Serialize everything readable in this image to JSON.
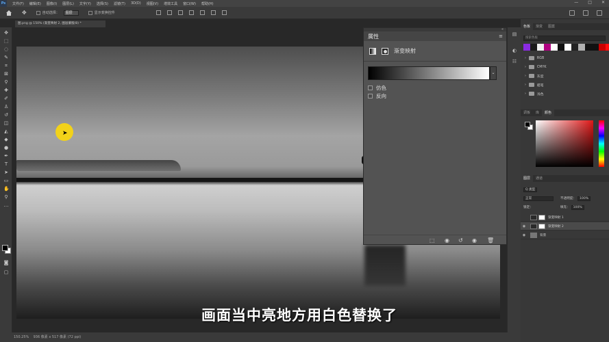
{
  "menu": {
    "logo": "Ps",
    "items": [
      "文件(F)",
      "编辑(E)",
      "图像(I)",
      "图层(L)",
      "文字(Y)",
      "选择(S)",
      "滤镜(T)",
      "3D(D)",
      "视图(V)",
      "增效工具",
      "窗口(W)",
      "帮助(H)"
    ],
    "window_buttons": [
      "—",
      "□",
      "✕"
    ]
  },
  "options_bar": {
    "auto_select_label": "自动选择：",
    "auto_select_value": "图层",
    "show_transform_label": "显示变换控件"
  },
  "document_tab": {
    "label": "图.png @ 150% (渐变映射 2, 图层蒙版/8) *"
  },
  "properties_panel": {
    "title": "属性",
    "adjustment_name": "渐变映射",
    "options": [
      "仿色",
      "反向"
    ]
  },
  "right_panels": {
    "top_tabs": [
      "色板",
      "渐变",
      "图案"
    ],
    "search_placeholder": "搜索色板",
    "swatch_colors": [
      "#8a2be2",
      "#1a1a1a",
      "#f0f0f0",
      "#b00080",
      "#ffffff",
      "#111111",
      "#ffffff",
      "#222222",
      "#b0b0b0",
      "#111111",
      "#111111",
      "#cc0000",
      "#ff1111",
      "#3a3a3a",
      "#ffffff"
    ],
    "swatch_groups": [
      "RGB",
      "CMYK",
      "灰度",
      "蜡笔",
      "浅色"
    ],
    "color_tabs": [
      "调板",
      "库",
      "颜色"
    ],
    "layers_tabs": [
      "图层",
      "通道"
    ],
    "layer_kind": "Q 类型",
    "blend_mode": "正常",
    "opacity_label": "不透明度：",
    "opacity_value": "100%",
    "lock_label": "锁定：",
    "fill_label": "填充：",
    "fill_value": "100%",
    "layers": [
      {
        "name": "渐变映射 1",
        "visible": false,
        "active": false
      },
      {
        "name": "渐变映射 2",
        "visible": true,
        "active": true
      },
      {
        "name": "背景",
        "visible": true,
        "active": false
      }
    ]
  },
  "status_bar": {
    "zoom": "150.25%",
    "doc_info": "936 像素 x 517 像素 (72 ppi)"
  },
  "subtitle": "画面当中亮地方用白色替换了"
}
